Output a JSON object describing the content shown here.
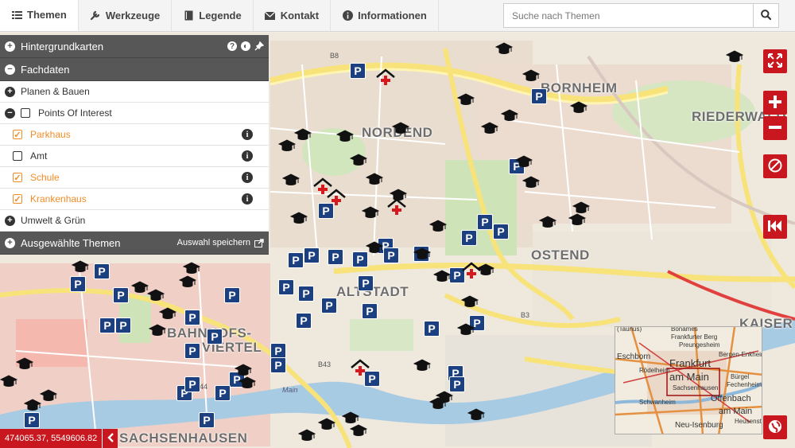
{
  "nav": {
    "tabs": [
      {
        "label": "Themen",
        "icon": "list-icon"
      },
      {
        "label": "Werkzeuge",
        "icon": "wrench-icon"
      },
      {
        "label": "Legende",
        "icon": "book-icon"
      },
      {
        "label": "Kontakt",
        "icon": "envelope-icon"
      },
      {
        "label": "Informationen",
        "icon": "info-icon"
      }
    ],
    "active_tab": "Themen"
  },
  "search": {
    "placeholder": "Suche nach Themen",
    "value": ""
  },
  "panel": {
    "hintergrundkarten": "Hintergrundkarten",
    "fachdaten": "Fachdaten",
    "planen_bauen": "Planen & Bauen",
    "poi": "Points Of Interest",
    "layers": [
      {
        "label": "Parkhaus",
        "checked": true
      },
      {
        "label": "Amt",
        "checked": false
      },
      {
        "label": "Schule",
        "checked": true
      },
      {
        "label": "Krankenhaus",
        "checked": true
      }
    ],
    "umwelt": "Umwelt & Grün",
    "ausgewaehlte": "Ausgewählte Themen",
    "save_label": "Auswahl speichern"
  },
  "map": {
    "districts": [
      {
        "name": "BORNHEIM"
      },
      {
        "name": "RIEDERWALD"
      },
      {
        "name": "NORDEND"
      },
      {
        "name": "OSTEND"
      },
      {
        "name": "ALTSTADT"
      },
      {
        "name": "BAHNHOFS-"
      },
      {
        "name": "VIERTEL"
      },
      {
        "name": "KAISER"
      },
      {
        "name": "SACHSENHAUSEN"
      }
    ],
    "road_labels": [
      "B8",
      "B3",
      "B43",
      "B44",
      "Main"
    ],
    "marker_symbols": {
      "parking": "P"
    }
  },
  "overview": {
    "labels": [
      "Bonames",
      "Frankfurter Berg",
      "Preungesheim",
      "Bergen-Enkheim",
      "Eschborn",
      "Frankfurt",
      "am Main",
      "Offenbach",
      "am Main",
      "Neu-Isenburg",
      "Heusenst",
      "Sachsenhausen",
      "Rödelheim",
      "Schwanheim",
      "Bürgel",
      "Fechenheim",
      "(Taunus)"
    ]
  },
  "coords": {
    "value": "474065.37, 5549606.82"
  },
  "colors": {
    "accent": "#c8171e",
    "parking": "#1c3f80",
    "layer_active": "#f28c28",
    "panel_header": "#575757"
  }
}
